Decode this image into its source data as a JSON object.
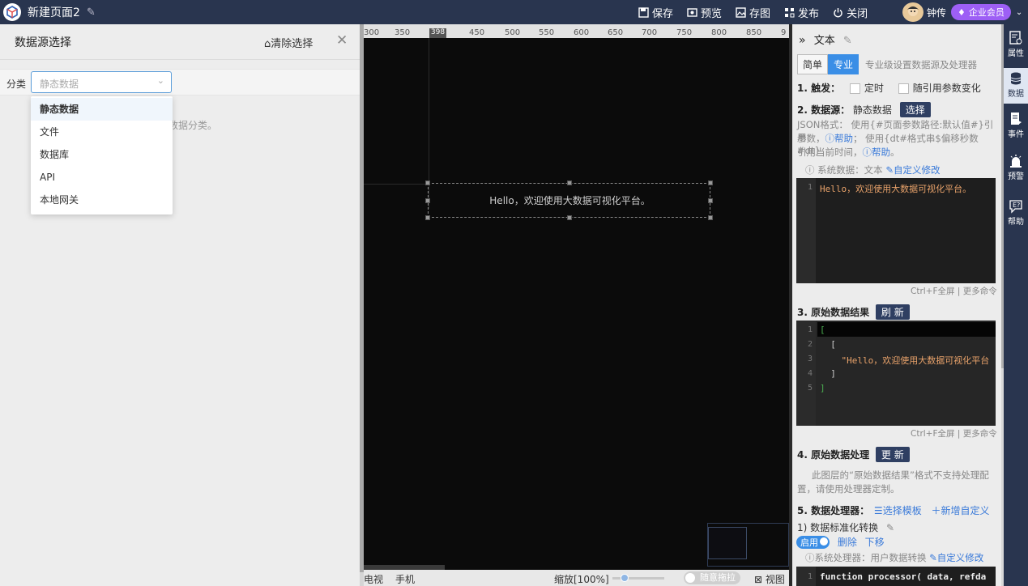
{
  "app": {
    "page_title": "新建页面2",
    "actions": [
      {
        "label": "保存",
        "icon": "save-icon"
      },
      {
        "label": "预览",
        "icon": "preview-icon"
      },
      {
        "label": "存图",
        "icon": "image-icon"
      },
      {
        "label": "发布",
        "icon": "publish-icon"
      },
      {
        "label": "关闭",
        "icon": "power-icon"
      }
    ],
    "user": {
      "name": "钟传",
      "badge": "企业会员"
    }
  },
  "left_panel": {
    "title": "数据源选择",
    "clear_label": "清除选择",
    "filter_label": "分类",
    "select_placeholder": "静态数据",
    "hint_suffix": "数据分类。",
    "options": [
      "静态数据",
      "文件",
      "数据库",
      "API",
      "本地网关"
    ],
    "selected_option": "静态数据"
  },
  "canvas": {
    "ruler_ticks": [
      "300",
      "350",
      "398",
      "450",
      "500",
      "550",
      "600",
      "650",
      "700",
      "750",
      "800",
      "850",
      "9"
    ],
    "component_text": "Hello，欢迎使用大数据可视化平台。",
    "bottom_left": [
      "电视",
      "手机"
    ],
    "zoom_label": "缩放[100%]",
    "drag_label": "随意拖拉",
    "view_label": "视图"
  },
  "right_panel": {
    "title": "文本",
    "mode_simple": "简单",
    "mode_pro": "专业",
    "mode_note": "专业级设置数据源及处理器",
    "trigger_label": "1. 触发：",
    "trigger_options": [
      "定时",
      "随引用参数变化"
    ],
    "datasource_label": "2. 数据源：",
    "datasource_value": "静态数据",
    "select_btn": "选择",
    "json_help_1": "JSON格式： 使用{#页面参数路径:默认值#}引用",
    "json_help_2a": "参数，",
    "json_help_2b": "帮助",
    "json_help_2c": "； 使用{dt#格式串$偏移秒数#dt}",
    "json_help_3a": "引用当前时间，",
    "json_help_3b": "帮助",
    "json_help_3c": "。",
    "sysdata_label": "ⓘ 系统数据：文本",
    "sysdata_custom": "自定义修改",
    "editor1_line1": "Hello，欢迎使用大数据可视化平台。",
    "editor1_line_no": "1",
    "editor_footer": "Ctrl+F全屏 | 更多命令",
    "raw_result_label": "3. 原始数据结果",
    "refresh_btn": "刷 新",
    "raw_lines": [
      "[",
      "  [",
      "    \"Hello，欢迎使用大数据可视化平台",
      "  ]",
      "]"
    ],
    "raw_line_nos": [
      "1",
      "2",
      "3",
      "4",
      "5"
    ],
    "process_label": "4. 原始数据处理",
    "update_btn": "更 新",
    "process_note_1": "此图层的“原始数据结果”格式不支持处理配",
    "process_note_2": "置，请使用处理器定制。",
    "processor_label": "5. 数据处理器：",
    "choose_template": "选择模板",
    "add_custom": "新增自定义",
    "proc_item": "1)   数据标准化转换",
    "enable_label": "启用",
    "delete_label": "删除",
    "move_down": "下移",
    "sysproc_label": "ⓘ系统处理器：用户数据转换",
    "sysproc_custom": "自定义修改",
    "code_line": "function processor( data, refda",
    "code_line_no": "1"
  },
  "side_nav": [
    {
      "label": "属性",
      "icon": "properties-icon"
    },
    {
      "label": "数据",
      "icon": "database-icon"
    },
    {
      "label": "事件",
      "icon": "event-icon"
    },
    {
      "label": "预警",
      "icon": "alarm-icon"
    },
    {
      "label": "帮助",
      "icon": "help-icon"
    }
  ]
}
